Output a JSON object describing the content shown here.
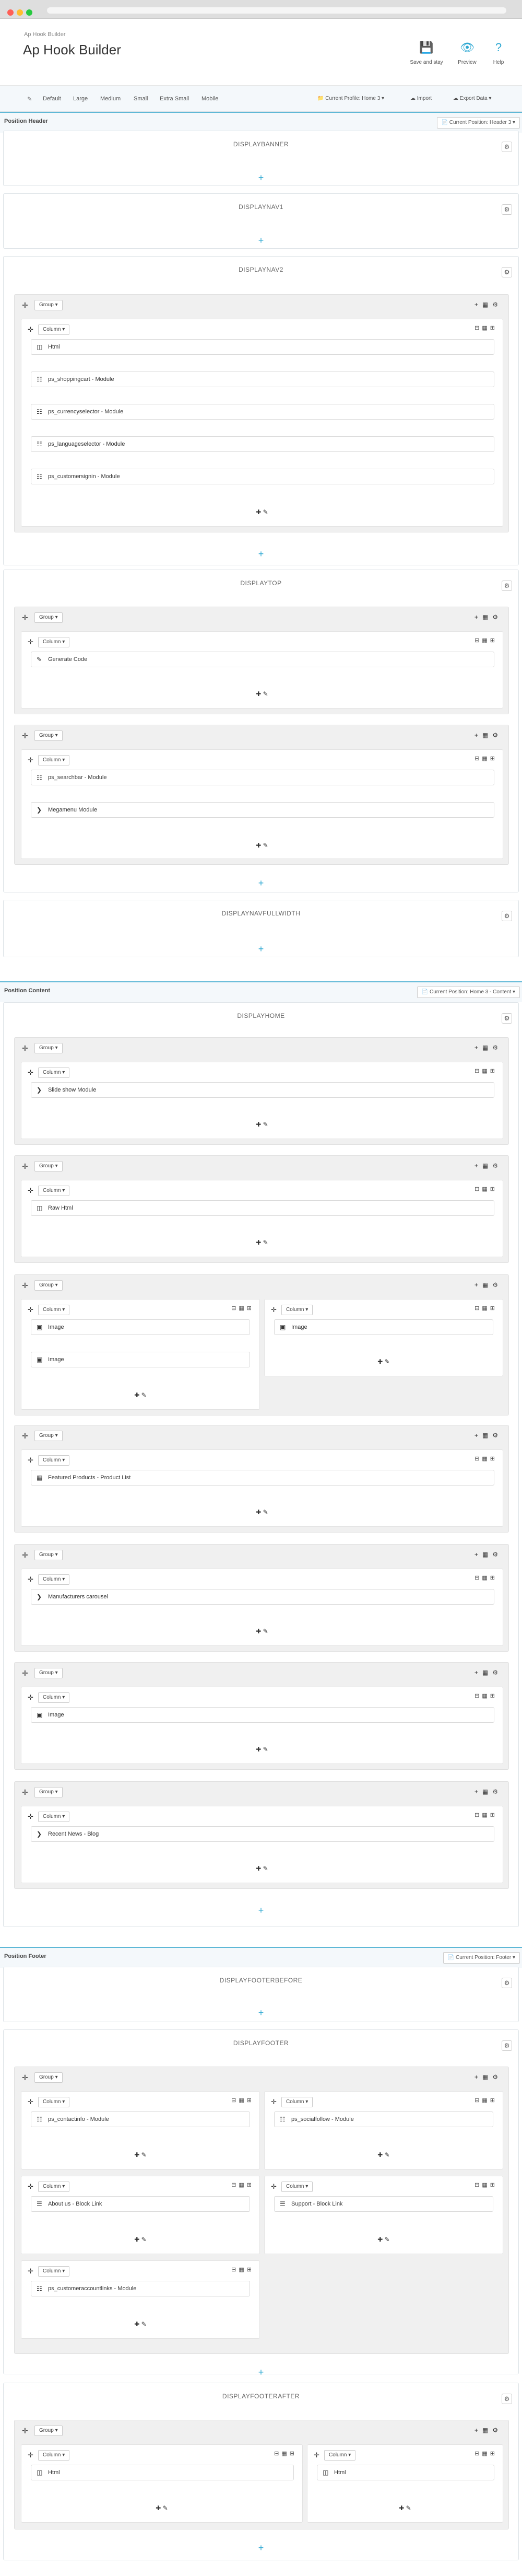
{
  "app": {
    "breadcrumb": "Ap Hook Builder",
    "title": "Ap Hook Builder",
    "buttons": [
      {
        "label": "Save and stay",
        "icon": "save-icon"
      },
      {
        "label": "Preview",
        "icon": "eye-icon"
      },
      {
        "label": "Help",
        "icon": "help-icon"
      }
    ]
  },
  "toolbar": {
    "sizes": [
      "Default",
      "Large",
      "Medium",
      "Small",
      "Extra Small",
      "Mobile"
    ],
    "profile": "Current Profile: Home 3",
    "import": "Import",
    "export": "Export Data"
  },
  "positions": {
    "header": {
      "name": "Position Header",
      "current": "Current Position: Header 3"
    },
    "content": {
      "name": "Position Content",
      "current": "Current Position: Home 3 - Content"
    },
    "footer": {
      "name": "Position Footer",
      "current": "Current Position: Footer"
    }
  },
  "labels": {
    "group": "Group",
    "column": "Column"
  },
  "hooks": {
    "displaybanner": "DISPLAYBANNER",
    "displaynav1": "DISPLAYNAV1",
    "displaynav2": "DISPLAYNAV2",
    "displaytop": "DISPLAYTOP",
    "displaynavfullwidth": "DISPLAYNAVFULLWIDTH",
    "displayhome": "DISPLAYHOME",
    "displayfooterbefore": "DISPLAYFOOTERBEFORE",
    "displayfooter": "DISPLAYFOOTER",
    "displayfooterafter": "DISPLAYFOOTERAFTER"
  },
  "widgets": {
    "nav2": [
      "Html",
      "ps_shoppingcart - Module",
      "ps_currencyselector - Module",
      "ps_languageselector - Module",
      "ps_customersignin - Module"
    ],
    "top1": [
      "Generate Code"
    ],
    "top2": [
      "ps_searchbar - Module",
      "Megamenu Module"
    ],
    "home": [
      "Slide show Module",
      "Raw Html",
      "Image",
      "Image",
      "Image",
      "Featured Products - Product List",
      "Manufacturers carousel",
      "Image",
      "Recent News - Blog"
    ],
    "footer": [
      "ps_contactinfo - Module",
      "ps_socialfollow - Module",
      "About us - Block Link",
      "Support - Block Link",
      "ps_customeraccountlinks - Module"
    ],
    "footerafter": [
      "Html",
      "Html"
    ]
  }
}
